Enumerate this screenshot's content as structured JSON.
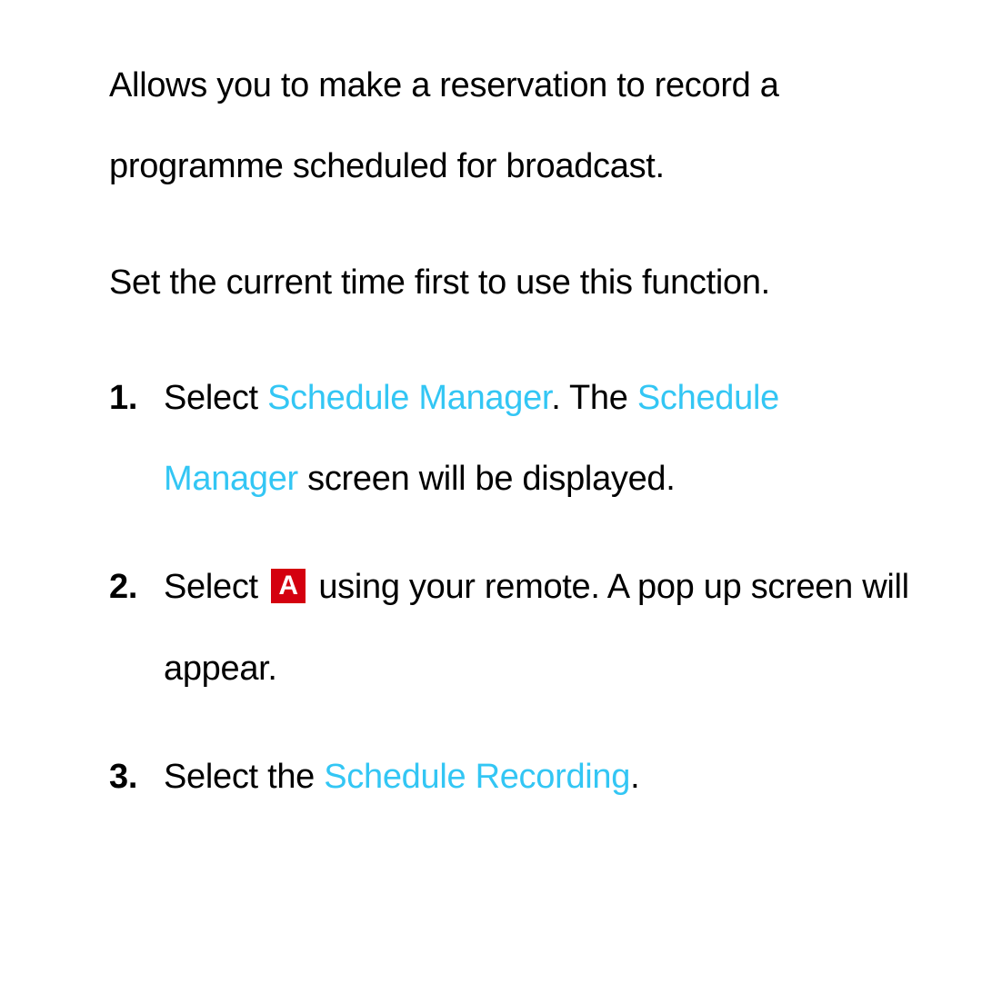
{
  "intro": {
    "p1": "Allows you to make a reservation to record a programme scheduled for broadcast.",
    "p2": "Set the current time first to use this function."
  },
  "steps": [
    {
      "marker": "1.",
      "parts": {
        "a": "Select ",
        "hl1": "Schedule Manager",
        "b": ". The ",
        "hl2": "Schedule Manager",
        "c": " screen will be displayed."
      }
    },
    {
      "marker": "2.",
      "parts": {
        "a": "Select ",
        "badge": "A",
        "b": " using your remote. A pop up screen will appear."
      }
    },
    {
      "marker": "3.",
      "parts": {
        "a": "Select the ",
        "hl1": "Schedule Recording",
        "b": "."
      }
    }
  ]
}
